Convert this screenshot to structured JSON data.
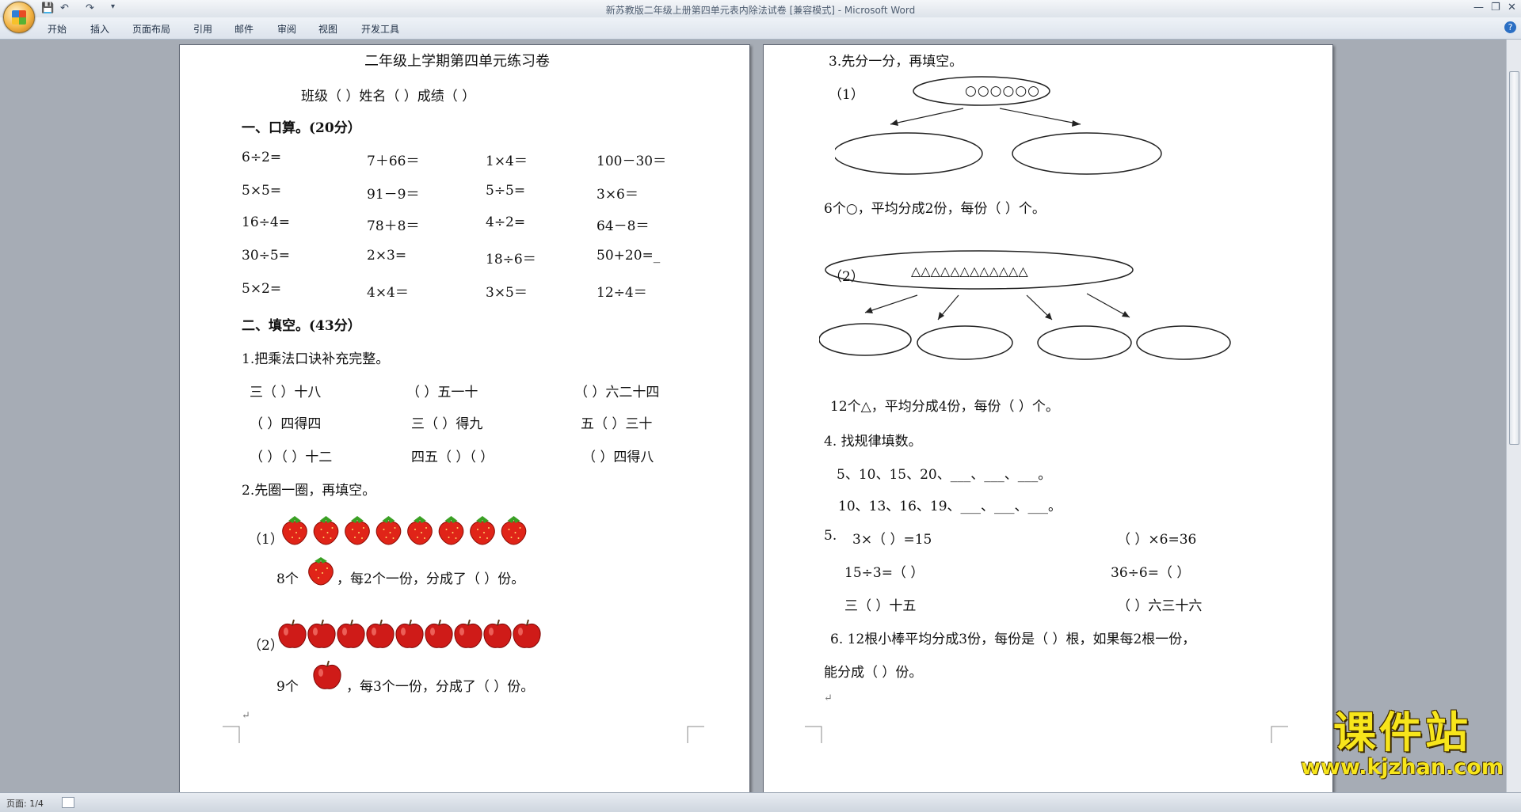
{
  "window": {
    "title": "新苏教版二年级上册第四单元表内除法试卷 [兼容模式] - Microsoft Word",
    "quick_access": [
      "save-icon",
      "undo-icon",
      "redo-icon",
      "customize-icon"
    ],
    "controls": [
      "—",
      "❐",
      "✕"
    ]
  },
  "ribbon": {
    "tabs": [
      "开始",
      "插入",
      "页面布局",
      "引用",
      "邮件",
      "审阅",
      "视图",
      "开发工具"
    ],
    "help": "?"
  },
  "page1": {
    "title": "二年级上学期第四单元练习卷",
    "info": "班级（        ）姓名（        ）成绩（      ）",
    "sec1": "一、口算。(20分）",
    "calc": [
      [
        "6÷2=",
        "7＋66＝",
        "1×4＝",
        "100－30＝"
      ],
      [
        "5×5=",
        "91－9＝",
        "5÷5=",
        "3×6＝"
      ],
      [
        "16÷4=",
        "78＋8＝",
        "4÷2=",
        "64－8＝"
      ],
      [
        "30÷5=",
        "2×3=",
        "18÷6＝",
        "50+20=_"
      ],
      [
        "5×2=",
        "4×4＝",
        "3×5＝",
        "12÷4＝"
      ]
    ],
    "sec2": "二、填空。(43分）",
    "q1": "1.把乘法口诀补充完整。",
    "verse": [
      [
        "三（    ）十八",
        "（    ）五一十",
        "（    ）六二十四"
      ],
      [
        "（    ）四得四",
        "三（    ）得九",
        "五（    ）三十"
      ],
      [
        "（    ）（    ）十二",
        "四五（    ）（    ）",
        "（    ）四得八"
      ]
    ],
    "q2": "2.先圈一圈，再填空。",
    "q2_1_label": "（1）",
    "q2_1_a": "8个",
    "q2_1_b": "，每2个一份，分成了（     ）份。",
    "q2_2_label": "（2）",
    "q2_2_a": "9个",
    "q2_2_b": "，每3个一份，分成了（     ）份。",
    "strawberry_count": 8,
    "apple_count": 9
  },
  "page2": {
    "q3": "3.先分一分，再填空。",
    "q3_1_label": "（1）",
    "q3_1_circles": "○○○○○○",
    "q3_1_text": "6个○，平均分成2份，每份（    ）个。",
    "q3_2_label": "（2）",
    "q3_2_triangles": "△△△△△△△△△△△△",
    "q3_2_text": "12个△，平均分成4份，每份（    ）个。",
    "q4": "4. 找规律填数。",
    "seq1": "5、10、15、20、___、___、___。",
    "seq2": "10、13、16、19、___、___、___。",
    "q5_label": "5.",
    "q5": [
      [
        "3×（  ）=15",
        "（    ）×6=36"
      ],
      [
        "15÷3=（   ）",
        "36÷6=（   ）"
      ],
      [
        "三（    ）十五",
        "（    ）六三十六"
      ]
    ],
    "q6_line1": "6. 12根小棒平均分成3份，每份是（       ）根，如果每2根一份，",
    "q6_line2": "能分成（      ）份。"
  },
  "status": {
    "page": "页面: 1/4"
  },
  "watermark": {
    "main": "课件站",
    "sub": "www.kjzhan.com"
  }
}
